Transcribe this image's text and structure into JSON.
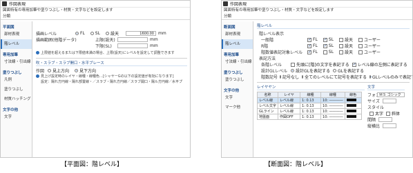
{
  "left": {
    "title": "作図表現",
    "desc": "図面特有の専用加筆や塗りつぶし・材質・文字などを設定します",
    "classify": "分類",
    "sidebar": {
      "cat1": "平面図",
      "items1": [
        "部材表現",
        "階レベル"
      ],
      "cat2": "専用加筆",
      "items2": [
        "寸法線・引出線"
      ],
      "cat3": "塗りつぶし",
      "items3": [
        "凡例",
        "塗りつぶし",
        "材質ハッチング"
      ],
      "cat4": "文字の他",
      "items4": [
        "文字"
      ]
    },
    "level_label": "描画レベル",
    "radio_fl": "FL",
    "radio_sl": "SL",
    "radio_ceiling": "設天",
    "level_value": "1600.00",
    "unit_mm": "mm",
    "range_label": "描画範囲(他階データ)",
    "upper_label": "上限(設天)",
    "lower_label": "下限(SL)",
    "note1": "上限値を超えるまたは下限値未満の場合、上限(設天)にレベルを設定して調整できます",
    "section2": "吹・スラブ・スラブ開口・水平ブレース",
    "direction_label": "作図",
    "radio_up": "見上方向",
    "radio_down": "見下方向",
    "note2": "見上げ設定時のレイヤ・線種・線種色…[シャヤーGの以下の設定値が有効になります]",
    "note3": "設定：陽れ方円線・陽れ部置線・／スラブ・陽れ方円線／スラブ開口・陽ル方円線／水平プ"
  },
  "right": {
    "title": "作図表現",
    "desc": "図面特有の専用加筆や塗りつぶし・材質・文字などを設定します",
    "classify": "分類",
    "sidebar": {
      "cat1": "断面図",
      "items1": [
        "部材表現",
        "階レベル"
      ],
      "cat2": "専用加筆",
      "items2": [
        "寸法線・引出線"
      ],
      "cat3": "塗りつぶし",
      "items3": [
        "塗りつぶし"
      ],
      "cat4": "文字の他",
      "items4": [
        "文字",
        "マーク他"
      ]
    },
    "section1": "階レベル",
    "level_display": "階レベル表示",
    "rows": [
      {
        "label": "一般階",
        "checks": [
          true,
          true,
          false,
          false
        ]
      },
      {
        "label": "R階",
        "checks": [
          true,
          true,
          false,
          false
        ]
      },
      {
        "label": "階数値表記対象レベル",
        "checks": [
          true,
          false,
          false,
          false
        ]
      }
    ],
    "check_labels": [
      "FL",
      "SL",
      "設天",
      "ユーザー"
    ],
    "method_label": "表記方法",
    "each_level": "各階レベル",
    "opt_prefix": "先頭に[階]の文字を表記する",
    "opt_right": "レベル線の左側に表記する",
    "gl_level": "設計GLレベル",
    "gl_opt1": "設計GLを表記する",
    "gl_opt2": "GLを表記する",
    "number_label": "階数記号",
    "num_opt1": "記号なし",
    "num_opt2": "全てのレベルにて記号を表記する",
    "num_opt3": "GLレベルのみで表記する",
    "layer_section": "レイヤヤン",
    "table_headers": [
      "名称",
      "レイヤ",
      "線種",
      "線種",
      "線色"
    ],
    "table_rows": [
      [
        "レベル線",
        "レベル線",
        "1: 0.13",
        "10: ――――",
        ""
      ],
      [
        "レベル文字",
        "レベル線",
        "1: 0.13",
        "10: ――――",
        ""
      ],
      [
        "GLライン",
        "レベル線",
        "1: 0.13",
        "10: ――――",
        ""
      ],
      [
        "地盤面",
        "作図OFF",
        "1: 0.13",
        "10: ――――",
        ""
      ]
    ],
    "text_section": "文字",
    "font_label": "フォント",
    "font_value": "ＭＳ ゴシック",
    "size_label": "サイズ",
    "style_label": "スタイル",
    "bold_label": "太字",
    "italic_label": "斜体",
    "spacing_label": "間隔",
    "ratio_label": "縦横比"
  },
  "captions": {
    "left": "【平面図：階レベル】",
    "right": "【断面図：階レベル】"
  }
}
